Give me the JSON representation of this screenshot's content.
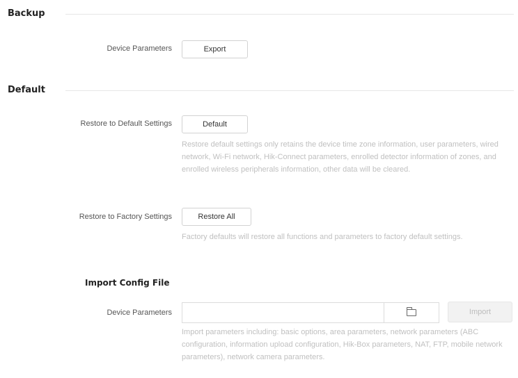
{
  "backup": {
    "title": "Backup",
    "device_parameters_label": "Device Parameters",
    "export_button": "Export"
  },
  "default": {
    "title": "Default",
    "restore_default_label": "Restore to Default Settings",
    "default_button": "Default",
    "restore_default_desc": "Restore default settings only retains the device time zone information, user parameters, wired network, Wi-Fi network, Hik-Connect parameters, enrolled detector information of zones, and enrolled wireless peripherals information, other data will be cleared.",
    "restore_factory_label": "Restore to Factory Settings",
    "restore_all_button": "Restore All",
    "restore_factory_desc": "Factory defaults will restore all functions and parameters to factory default settings."
  },
  "import": {
    "title": "Import Config File",
    "device_parameters_label": "Device Parameters",
    "file_value": "",
    "browse_icon": "folder-icon",
    "import_button": "Import",
    "import_desc": "Import parameters including: basic options, area parameters, network parameters (ABC configuration, information upload configuration, Hik-Box parameters, NAT, FTP, mobile network parameters), network camera parameters."
  }
}
